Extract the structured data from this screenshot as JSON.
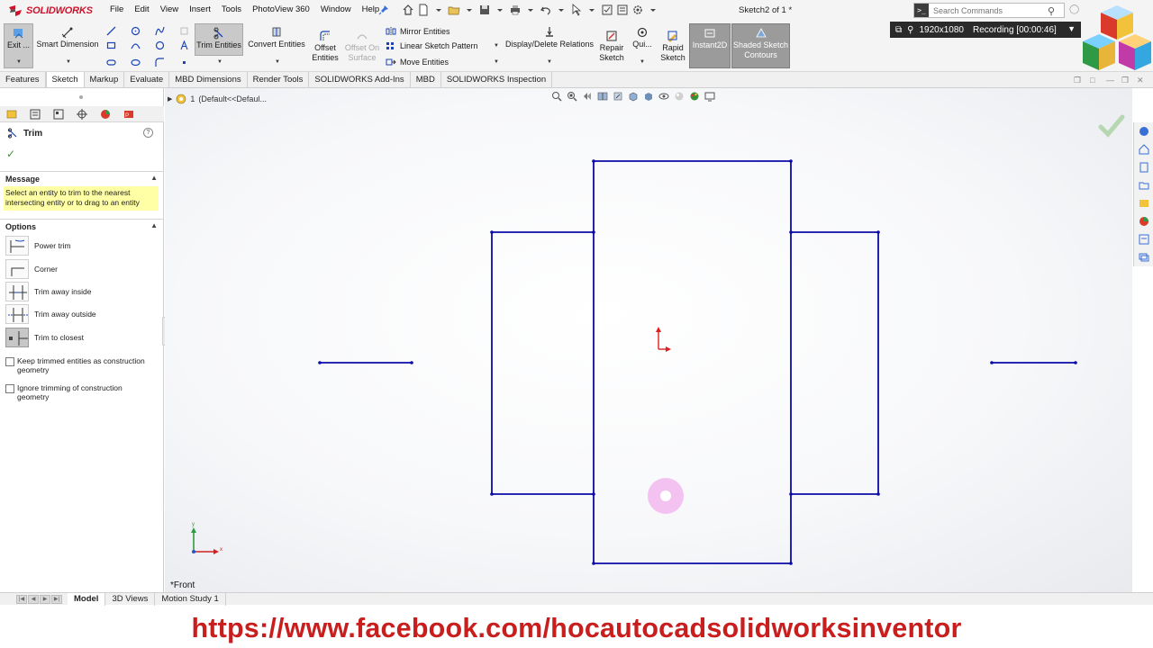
{
  "app": {
    "brand": "SOLIDWORKS",
    "document_title": "Sketch2 of 1 *"
  },
  "menus": [
    "File",
    "Edit",
    "View",
    "Insert",
    "Tools",
    "PhotoView 360",
    "Window",
    "Help"
  ],
  "search": {
    "placeholder": "Search Commands"
  },
  "recording": {
    "resolution": "1920x1080",
    "status": "Recording [00:00:46]"
  },
  "ribbon": {
    "exit_label": "Exit ...",
    "smart_dimension": "Smart Dimension",
    "trim_entities": "Trim Entities",
    "convert_entities": "Convert Entities",
    "offset_entities": "Offset Entities",
    "offset_on_surface": "Offset On Surface",
    "mirror_entities": "Mirror Entities",
    "linear_sketch_pattern": "Linear Sketch Pattern",
    "move_entities": "Move Entities",
    "display_delete_relations": "Display/Delete Relations",
    "repair_sketch": "Repair Sketch",
    "quick_snaps": "Qui...",
    "rapid_sketch": "Rapid Sketch",
    "instant2d": "Instant2D",
    "shaded_sketch_contours": "Shaded Sketch Contours"
  },
  "tabs": [
    "Features",
    "Sketch",
    "Markup",
    "Evaluate",
    "MBD Dimensions",
    "Render Tools",
    "SOLIDWORKS Add-Ins",
    "MBD",
    "SOLIDWORKS Inspection"
  ],
  "active_tab": "Sketch",
  "property_manager": {
    "title": "Trim",
    "message_header": "Message",
    "message": "Select an entity to trim to the nearest intersecting entity or to drag to an entity",
    "options_header": "Options",
    "options": [
      {
        "label": "Power trim",
        "selected": false
      },
      {
        "label": "Corner",
        "selected": false
      },
      {
        "label": "Trim away inside",
        "selected": false
      },
      {
        "label": "Trim away outside",
        "selected": false
      },
      {
        "label": "Trim to closest",
        "selected": true
      }
    ],
    "checkboxes": [
      {
        "label": "Keep trimmed entities as construction geometry",
        "checked": false
      },
      {
        "label": "Ignore trimming of construction geometry",
        "checked": false
      }
    ]
  },
  "graphics": {
    "tree_label": "(Default<<Defaul...",
    "tree_index": "1",
    "view_name": "*Front",
    "sketch_color": "#0b0ba8",
    "origin_color": "#e02020"
  },
  "bottom_tabs": [
    "Model",
    "3D Views",
    "Motion Study 1"
  ],
  "active_bottom_tab": "Model",
  "footer": {
    "url": "https://www.facebook.com/hocautocadsolidworksinventor"
  }
}
